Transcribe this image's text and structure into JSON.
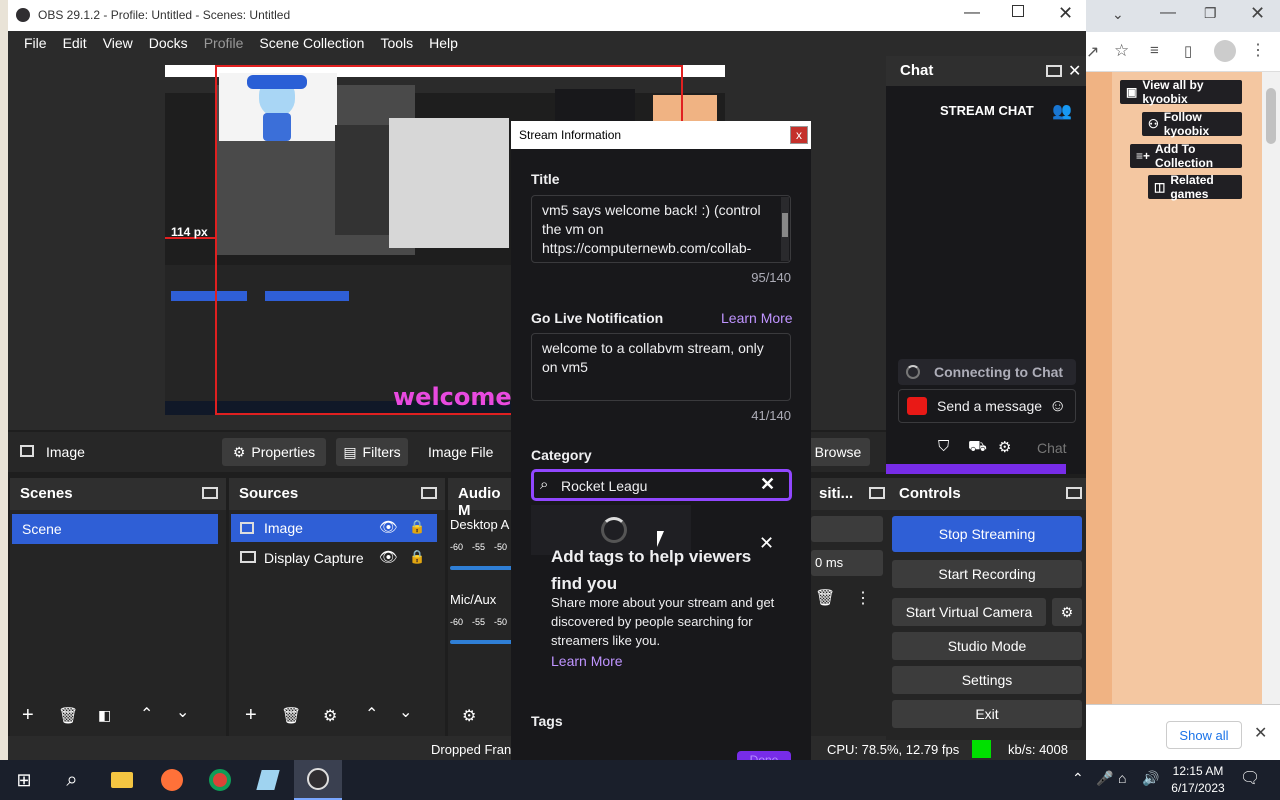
{
  "obs": {
    "title": "OBS 29.1.2 - Profile: Untitled - Scenes: Untitled",
    "menu": [
      "File",
      "Edit",
      "View",
      "Docks",
      "Profile",
      "Scene Collection",
      "Tools",
      "Help"
    ],
    "preview": {
      "measure_label": "114 px",
      "welcome_text": "welcome"
    },
    "infobar": {
      "source_name": "Image",
      "properties": "Properties",
      "filters": "Filters",
      "image_file": "Image File",
      "browse": "Browse"
    },
    "scenes": {
      "title": "Scenes",
      "items": [
        "Scene"
      ]
    },
    "sources": {
      "title": "Sources",
      "items": [
        "Image",
        "Display Capture"
      ]
    },
    "audio": {
      "title": "Audio M",
      "tracks": [
        {
          "name": "Desktop A"
        },
        {
          "name": "Mic/Aux"
        }
      ],
      "scale": [
        "-60",
        "-55",
        "-50"
      ]
    },
    "transitions": {
      "title": "siti...",
      "duration": "0 ms"
    },
    "controls": {
      "title": "Controls",
      "stop_streaming": "Stop Streaming",
      "start_recording": "Start Recording",
      "start_virtual_camera": "Start Virtual Camera",
      "studio_mode": "Studio Mode",
      "settings": "Settings",
      "exit": "Exit"
    },
    "status": {
      "dropped": "Dropped Fran",
      "cpu": "CPU: 78.5%, 12.79 fps",
      "kbs": "kb/s: 4008"
    }
  },
  "dialog": {
    "title": "Stream Information",
    "close": "x",
    "title_label": "Title",
    "title_value": "vm5 says welcome back! :) (control the vm on https://computernewb.com/collab-",
    "title_count": "95/140",
    "notif_label": "Go Live Notification",
    "notif_learn": "Learn More",
    "notif_value": "welcome to a collabvm stream, only on vm5",
    "notif_count": "41/140",
    "category_label": "Category",
    "category_value": "Rocket Leagu",
    "tags_heading": "Add tags to help viewers find you",
    "tags_body": "Share more about your stream and get discovered by people searching for streamers like you.",
    "tags_learn": "Learn More",
    "tags_label": "Tags",
    "done": "Done"
  },
  "chat": {
    "title": "Chat",
    "stream_chat": "STREAM CHAT",
    "connecting": "Connecting to Chat",
    "send_placeholder": "Send a message",
    "chat_btn": "Chat"
  },
  "browser": {
    "buttons": [
      "View all by kyoobix",
      "Follow kyoobix",
      "Add To Collection",
      "Related games"
    ],
    "show_all": "Show all"
  },
  "taskbar": {
    "time": "12:15 AM",
    "date": "6/17/2023"
  },
  "colors": {
    "accent": "#9147ff",
    "obs_blue": "#2f5fd6",
    "live_green": "#00e000"
  }
}
